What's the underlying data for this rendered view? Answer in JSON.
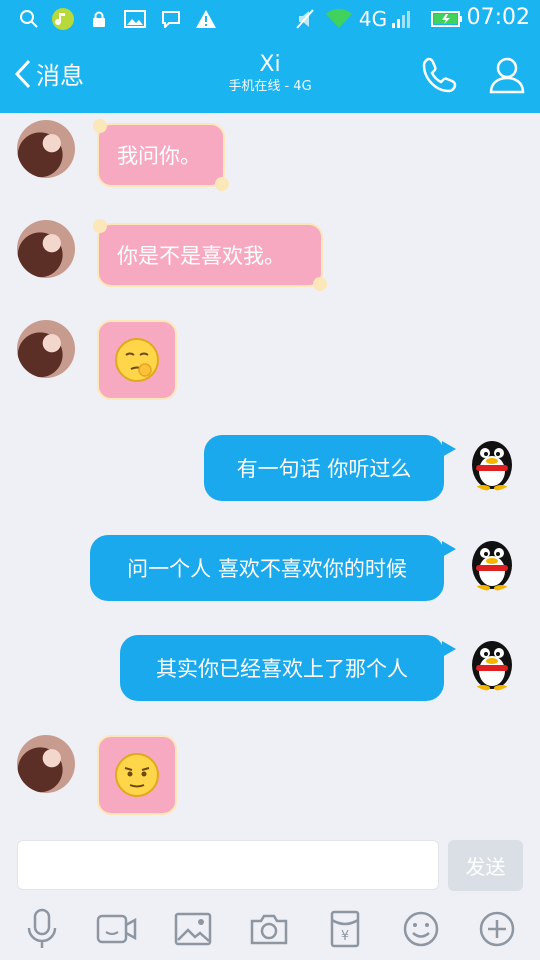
{
  "status_bar": {
    "time": "07:02",
    "network": "4G"
  },
  "header": {
    "back_label": "消息",
    "contact_name": "Xi",
    "contact_status": "手机在线 - 4G"
  },
  "messages": [
    {
      "side": "left",
      "type": "text",
      "text": "我问你。"
    },
    {
      "side": "left",
      "type": "text",
      "text": "你是不是喜欢我。"
    },
    {
      "side": "left",
      "type": "emoji",
      "emoji": "thinking-face"
    },
    {
      "side": "right",
      "type": "text",
      "text": "有一句话 你听过么"
    },
    {
      "side": "right",
      "type": "text",
      "text": "问一个人 喜欢不喜欢你的时候"
    },
    {
      "side": "right",
      "type": "text",
      "text": "其实你已经喜欢上了那个人"
    },
    {
      "side": "left",
      "type": "emoji",
      "emoji": "sly-face"
    }
  ],
  "input": {
    "value": "",
    "placeholder": "",
    "send_label": "发送"
  },
  "toolbar": [
    "microphone-icon",
    "video-icon",
    "image-icon",
    "camera-icon",
    "red-packet-icon",
    "emoji-icon",
    "plus-icon"
  ],
  "colors": {
    "accent": "#1ab4f0",
    "bubble_right": "#19a9ec",
    "bubble_left": "#f7a9c1",
    "background": "#eef0f5"
  }
}
